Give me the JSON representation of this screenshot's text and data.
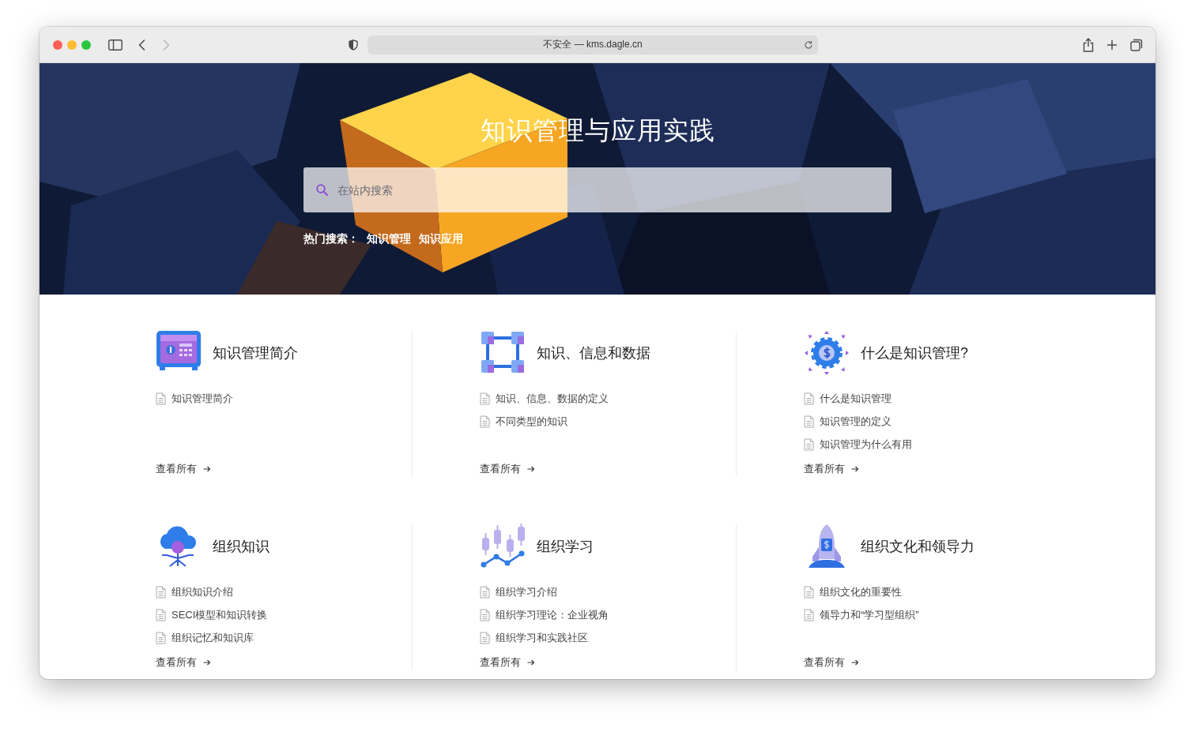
{
  "browser": {
    "back": {
      "disabled": false
    },
    "forward": {
      "disabled": true
    },
    "address": "不安全 — kms.dagle.cn"
  },
  "hero": {
    "kind": "picture",
    "title": "知识管理与应用实践",
    "search": {
      "placeholder": "在站内搜索"
    },
    "hot_search": {
      "label": "热门搜索：",
      "terms": [
        "知识管理",
        "知识应用"
      ]
    }
  },
  "categories": [
    {
      "kind": "safe",
      "title": "知识管理简介",
      "articles": [
        "知识管理简介"
      ],
      "view_all": "查看所有"
    },
    {
      "kind": "cubes",
      "title": "知识、信息和数据",
      "articles": [
        "知识、信息、数据的定义",
        "不同类型的知识"
      ],
      "view_all": "查看所有"
    },
    {
      "kind": "gear",
      "title": "什么是知识管理?",
      "articles": [
        "什么是知识管理",
        "知识管理的定义",
        "知识管理为什么有用"
      ],
      "view_all": "查看所有"
    },
    {
      "kind": "cloud",
      "title": "组织知识",
      "articles": [
        "组织知识介绍",
        "SECI模型和知识转换",
        "组织记忆和知识库"
      ],
      "view_all": "查看所有"
    },
    {
      "kind": "chart",
      "title": "组织学习",
      "articles": [
        "组织学习介绍",
        "组织学习理论：企业视角",
        "组织学习和实践社区"
      ],
      "view_all": "查看所有"
    },
    {
      "kind": "rocket",
      "title": "组织文化和领导力",
      "articles": [
        "组织文化的重要性",
        "领导力和“学习型组织”"
      ],
      "view_all": "查看所有"
    }
  ]
}
